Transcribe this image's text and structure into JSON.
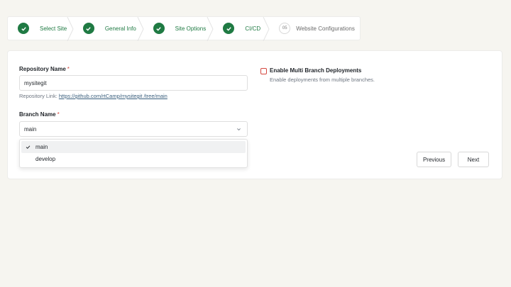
{
  "stepper": {
    "steps": [
      {
        "label": "Select Site",
        "state": "completed"
      },
      {
        "label": "General Info",
        "state": "completed"
      },
      {
        "label": "Site Options",
        "state": "completed"
      },
      {
        "label": "CI/CD",
        "state": "completed"
      },
      {
        "number": "05",
        "label": "Website Configurations",
        "state": "pending"
      }
    ]
  },
  "form": {
    "repository": {
      "label": "Repository Name",
      "required_mark": "*",
      "value": "mysitegit",
      "link_prefix": "Repository Link:",
      "link_text": "https://github.com/rtCamp/mysitegit /tree/main"
    },
    "branch": {
      "label": "Branch Name",
      "required_mark": "*",
      "value": "main",
      "options": [
        {
          "label": "main",
          "selected": true
        },
        {
          "label": "develop",
          "selected": false
        }
      ]
    },
    "multi_branch": {
      "label": "Enable Multi Branch Deployments",
      "description": "Enable deployments from multiple branches.",
      "checked": false
    }
  },
  "actions": {
    "previous_label": "Previous",
    "next_label": "Next"
  },
  "colors": {
    "accent_green": "#1f7a43",
    "required_red": "#d4473f",
    "page_bg": "#f6f5f0"
  },
  "icons": {
    "step_done": "check-icon",
    "select": "chevron-down-icon",
    "option_selected": "check-icon"
  }
}
